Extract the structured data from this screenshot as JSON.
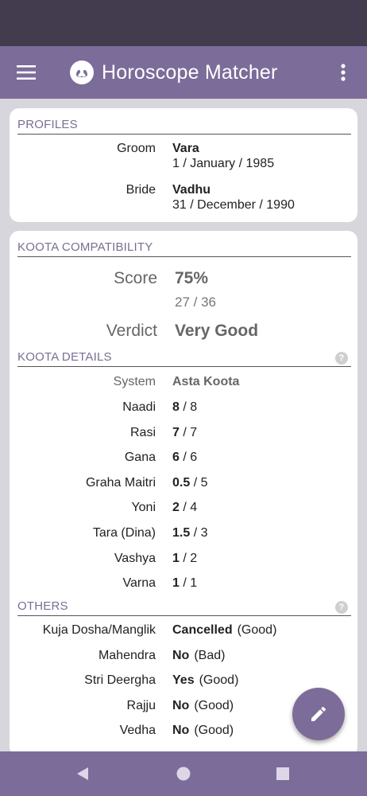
{
  "app": {
    "title": "Horoscope Matcher"
  },
  "profiles": {
    "heading": "PROFILES",
    "groom_label": "Groom",
    "groom_name": "Vara",
    "groom_dob": "1 / January / 1985",
    "bride_label": "Bride",
    "bride_name": "Vadhu",
    "bride_dob": "31 / December / 1990"
  },
  "compatibility": {
    "heading": "KOOTA COMPATIBILITY",
    "score_label": "Score",
    "score_percent": "75%",
    "score_points": "27",
    "score_max": "/ 36",
    "verdict_label": "Verdict",
    "verdict": "Very Good"
  },
  "koota_details": {
    "heading": "KOOTA DETAILS",
    "help": "?",
    "system_label": "System",
    "system_value": "Asta Koota",
    "rows": [
      {
        "label": "Naadi",
        "score": "8",
        "max": "/ 8"
      },
      {
        "label": "Rasi",
        "score": "7",
        "max": "/ 7"
      },
      {
        "label": "Gana",
        "score": "6",
        "max": "/ 6"
      },
      {
        "label": "Graha Maitri",
        "score": "0.5",
        "max": "/ 5"
      },
      {
        "label": "Yoni",
        "score": "2",
        "max": "/ 4"
      },
      {
        "label": "Tara (Dina)",
        "score": "1.5",
        "max": "/ 3"
      },
      {
        "label": "Vashya",
        "score": "1",
        "max": "/ 2"
      },
      {
        "label": "Varna",
        "score": "1",
        "max": "/ 1"
      }
    ]
  },
  "others": {
    "heading": "OTHERS",
    "help": "?",
    "rows": [
      {
        "label": "Kuja Dosha/Manglik",
        "value": "Cancelled",
        "note": "(Good)"
      },
      {
        "label": "Mahendra",
        "value": "No",
        "note": "(Bad)"
      },
      {
        "label": "Stri Deergha",
        "value": "Yes",
        "note": "(Good)"
      },
      {
        "label": "Rajju",
        "value": "No",
        "note": "(Good)"
      },
      {
        "label": "Vedha",
        "value": "No",
        "note": "(Good)"
      }
    ]
  },
  "icons": {
    "menu": "hamburger-menu-icon",
    "logo": "swan-logo-icon",
    "more": "more-vert-icon",
    "edit": "pencil-edit-icon",
    "nav_back": "triangle-back-icon",
    "nav_home": "circle-home-icon",
    "nav_recent": "square-recents-icon"
  },
  "colors": {
    "primary": "#7c6c99",
    "status_bar": "#433c4f",
    "section_heading": "#7b6e93",
    "background": "#d7d6dc"
  }
}
